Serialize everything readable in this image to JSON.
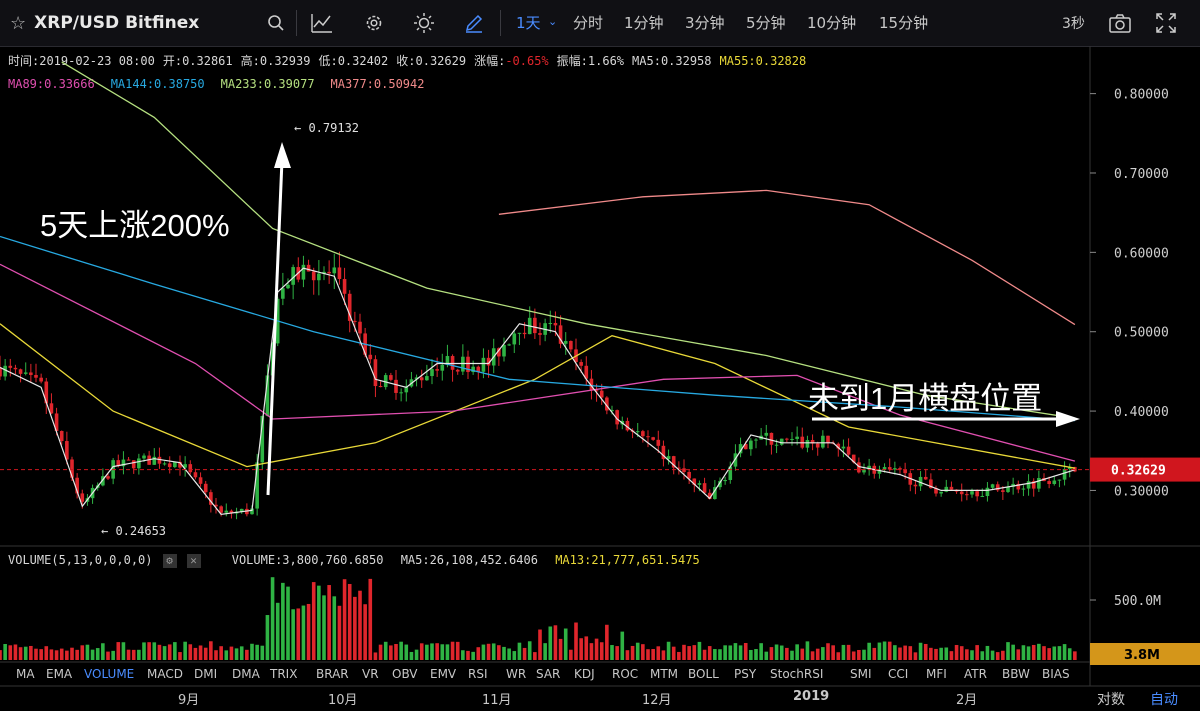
{
  "header": {
    "symbol": "XRP/USD Bitfinex",
    "periods": [
      "1天",
      "分时",
      "1分钟",
      "3分钟",
      "5分钟",
      "10分钟",
      "15分钟"
    ],
    "refresh": "3秒"
  },
  "ohlc": [
    {
      "label": "时间:",
      "value": "2019-02-23 08:00"
    },
    {
      "label": "开:",
      "value": "0.32861"
    },
    {
      "label": "高:",
      "value": "0.32939"
    },
    {
      "label": "低:",
      "value": "0.32402"
    },
    {
      "label": "收:",
      "value": "0.32629"
    },
    {
      "label": "涨幅:",
      "value": "-0.65%"
    },
    {
      "label": "振幅:",
      "value": "1.66%"
    },
    {
      "label": "MA5:",
      "value": "0.32958"
    },
    {
      "label": "MA55:",
      "value": "0.32828"
    }
  ],
  "ma_legend": [
    {
      "label": "MA89:",
      "value": "0.33666",
      "color": "#e04fb0"
    },
    {
      "label": "MA144:",
      "value": "0.38750",
      "color": "#27a9e1"
    },
    {
      "label": "MA233:",
      "value": "0.39077",
      "color": "#b5e080"
    },
    {
      "label": "MA377:",
      "value": "0.50942",
      "color": "#f08a8a"
    }
  ],
  "colors": {
    "up": "#2fb344",
    "down": "#e0262c",
    "ma5": "#e8e8e8",
    "ma55": "#e8d838",
    "ma13": "#e8d838",
    "price_badge": "#d0161e",
    "vol_badge": "#d4961a"
  },
  "annotations": {
    "left": "5天上涨200%",
    "right": "未到1月横盘位置",
    "high": "← 0.79132",
    "low": "← 0.24653"
  },
  "volume": {
    "title": "VOLUME(5,13,0,0,0,0)",
    "vol": "VOLUME:3,800,760.6850",
    "ma5": "MA5:26,108,452.6406",
    "ma13": "MA13:21,777,651.5475",
    "current": "3.8M",
    "axis_label": "500.0M"
  },
  "indicators": [
    "MA",
    "EMA",
    "VOLUME",
    "MACD",
    "DMI",
    "DMA",
    "TRIX",
    "BRAR",
    "VR",
    "OBV",
    "EMV",
    "RSI",
    "WR",
    "SAR",
    "KDJ",
    "ROC",
    "MTM",
    "BOLL",
    "PSY",
    "StochRSI",
    "SMI",
    "CCI",
    "MFI",
    "ATR",
    "BBW",
    "BIAS"
  ],
  "active_indicator": "VOLUME",
  "months": [
    "9月",
    "10月",
    "11月",
    "12月",
    "2019",
    "2月"
  ],
  "footer": {
    "log": "对数",
    "auto": "自动"
  },
  "chart_data": {
    "type": "candlestick",
    "y_axis_ticks": [
      "0.80000",
      "0.70000",
      "0.60000",
      "0.50000",
      "0.40000",
      "0.30000"
    ],
    "ylim": [
      0.23,
      0.86
    ],
    "current_price": "0.32629",
    "high_point": {
      "date": "2018-09-21",
      "value": 0.79132
    },
    "low_point": {
      "date": "2018-08-14",
      "value": 0.24653
    },
    "price_keypoints": [
      [
        "2018-07-29",
        0.455
      ],
      [
        "2018-08-06",
        0.43
      ],
      [
        "2018-08-14",
        0.28
      ],
      [
        "2018-08-20",
        0.33
      ],
      [
        "2018-08-28",
        0.34
      ],
      [
        "2018-09-02",
        0.335
      ],
      [
        "2018-09-10",
        0.27
      ],
      [
        "2018-09-16",
        0.275
      ],
      [
        "2018-09-21",
        0.55
      ],
      [
        "2018-09-26",
        0.58
      ],
      [
        "2018-10-02",
        0.57
      ],
      [
        "2018-10-10",
        0.44
      ],
      [
        "2018-10-16",
        0.43
      ],
      [
        "2018-10-22",
        0.46
      ],
      [
        "2018-11-01",
        0.46
      ],
      [
        "2018-11-07",
        0.51
      ],
      [
        "2018-11-14",
        0.5
      ],
      [
        "2018-11-20",
        0.44
      ],
      [
        "2018-11-26",
        0.39
      ],
      [
        "2018-12-04",
        0.35
      ],
      [
        "2018-12-14",
        0.29
      ],
      [
        "2018-12-22",
        0.37
      ],
      [
        "2018-12-28",
        0.36
      ],
      [
        "2019-01-07",
        0.36
      ],
      [
        "2019-01-12",
        0.33
      ],
      [
        "2019-01-20",
        0.32
      ],
      [
        "2019-01-28",
        0.3
      ],
      [
        "2019-02-06",
        0.3
      ],
      [
        "2019-02-15",
        0.31
      ],
      [
        "2019-02-23",
        0.326
      ]
    ],
    "ma_series": [
      {
        "name": "MA55",
        "points": [
          [
            "2018-07-29",
            0.51
          ],
          [
            "2018-08-20",
            0.4
          ],
          [
            "2018-09-15",
            0.33
          ],
          [
            "2018-10-10",
            0.36
          ],
          [
            "2018-11-10",
            0.44
          ],
          [
            "2018-11-25",
            0.495
          ],
          [
            "2018-12-15",
            0.46
          ],
          [
            "2019-01-10",
            0.38
          ],
          [
            "2019-02-23",
            0.328
          ]
        ]
      },
      {
        "name": "MA89",
        "points": [
          [
            "2018-07-29",
            0.585
          ],
          [
            "2018-09-05",
            0.46
          ],
          [
            "2018-09-20",
            0.39
          ],
          [
            "2018-10-25",
            0.4
          ],
          [
            "2018-12-05",
            0.44
          ],
          [
            "2018-12-31",
            0.445
          ],
          [
            "2019-01-20",
            0.395
          ],
          [
            "2019-02-23",
            0.337
          ]
        ]
      },
      {
        "name": "MA144",
        "points": [
          [
            "2018-07-29",
            0.62
          ],
          [
            "2018-08-28",
            0.56
          ],
          [
            "2018-09-28",
            0.5
          ],
          [
            "2018-11-05",
            0.44
          ],
          [
            "2018-12-15",
            0.42
          ],
          [
            "2019-01-20",
            0.405
          ],
          [
            "2019-02-23",
            0.388
          ]
        ]
      },
      {
        "name": "MA233",
        "points": [
          [
            "2018-08-10",
            0.84
          ],
          [
            "2018-08-28",
            0.77
          ],
          [
            "2018-09-20",
            0.63
          ],
          [
            "2018-10-20",
            0.555
          ],
          [
            "2018-11-20",
            0.51
          ],
          [
            "2018-12-25",
            0.47
          ],
          [
            "2019-01-25",
            0.42
          ],
          [
            "2019-02-23",
            0.391
          ]
        ]
      },
      {
        "name": "MA377",
        "points": [
          [
            "2018-11-03",
            0.648
          ],
          [
            "2018-12-01",
            0.67
          ],
          [
            "2018-12-25",
            0.678
          ],
          [
            "2019-01-14",
            0.66
          ],
          [
            "2019-02-03",
            0.59
          ],
          [
            "2019-02-23",
            0.509
          ]
        ]
      }
    ]
  }
}
